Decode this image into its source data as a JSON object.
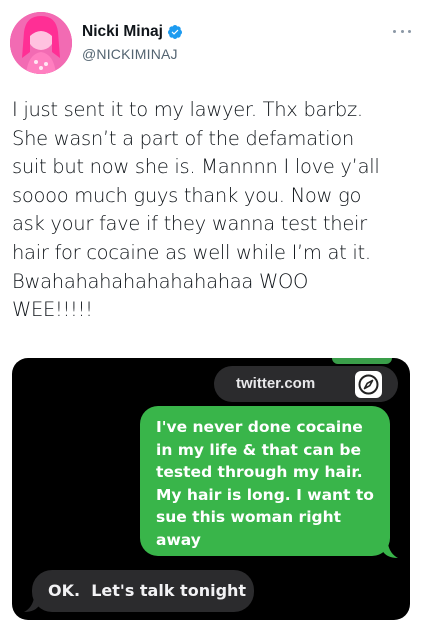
{
  "tweet": {
    "display_name": "Nicki Minaj",
    "handle": "@NICKIMINAJ",
    "text": "I just sent it to my lawyer. Thx barbz.\nShe wasn’t a part of the defamation\nsuit but now she is. Mannnn I love y’all\nsoooo much guys thank you. Now go\nask your fave if they wanna test their\nhair for cocaine as well while I’m at it.\nBwahahahahahahahahaa WOO\nWEE!!!!!"
  },
  "screenshot": {
    "link_text": "twitter.com",
    "sent_message": "I've never done cocaine\nin my life & that can be\ntested through my hair.\nMy hair is long. I want to\nsue this woman right\naway",
    "received_message": "OK.  Let's talk tonight"
  },
  "colors": {
    "verified": "#1d9bf0",
    "imessage_green": "#39b54a",
    "received_gray": "#2b2b2d"
  },
  "icons": [
    "verified-badge-icon",
    "more-options-icon",
    "safari-compass-icon"
  ]
}
